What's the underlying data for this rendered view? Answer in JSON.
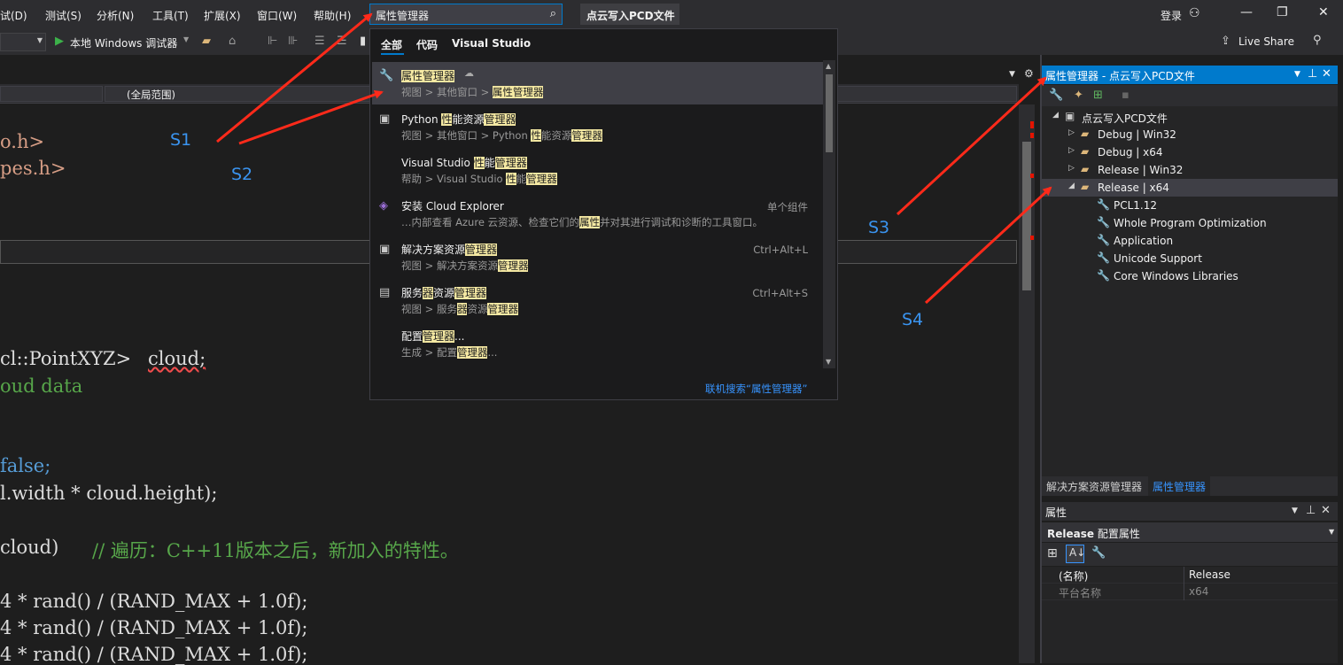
{
  "menu": [
    "试(D)",
    "测试(S)",
    "分析(N)",
    "工具(T)",
    "扩展(X)",
    "窗口(W)",
    "帮助(H)"
  ],
  "search": {
    "query": "属性管理器"
  },
  "solution_title": "点云写入PCD文件",
  "account": {
    "login": "登录"
  },
  "toolbar": {
    "debugger": "本地 Windows 调试器",
    "live_share": "Live Share"
  },
  "scope": {
    "global": "(全局范围)"
  },
  "code_lines": [
    {
      "id": "l1",
      "text": "o.h>"
    },
    {
      "id": "l2",
      "text": "pes.h>"
    },
    {
      "id": "l3",
      "text": "cl::PointXYZ> "
    },
    {
      "id": "l3b",
      "text": "cloud;"
    },
    {
      "id": "l4",
      "text": "oud data"
    },
    {
      "id": "l5",
      "text": "false;"
    },
    {
      "id": "l6",
      "text": "l.width * cloud.height);"
    },
    {
      "id": "l7a",
      "text": "cloud)   "
    },
    {
      "id": "l7b",
      "text": "// 遍历：C++11版本之后，新加入的特性。"
    },
    {
      "id": "l8",
      "text": "4 * rand() / (RAND_MAX + 1.0f);"
    },
    {
      "id": "l9",
      "text": "4 * rand() / (RAND_MAX + 1.0f);"
    },
    {
      "id": "l10",
      "text": "4 * rand() / (RAND_MAX + 1.0f);"
    }
  ],
  "popup": {
    "tabs": [
      "全部",
      "代码",
      "Visual Studio"
    ],
    "results": [
      {
        "title": [
          "",
          "属性管理器",
          ""
        ],
        "sub": [
          "视图 > 其他窗口 > ",
          "属性管理器",
          ""
        ],
        "right": "",
        "icon": "🔧"
      },
      {
        "title": [
          "Python ",
          "性",
          "能资源",
          "管理器"
        ],
        "sub": [
          "视图 > 其他窗口 > Python ",
          "性",
          "能资源",
          "管理器"
        ],
        "right": "",
        "icon": "▣"
      },
      {
        "title": [
          "Visual Studio ",
          "性",
          "能",
          "管理器"
        ],
        "sub": [
          "帮助 > Visual Studio ",
          "性",
          "能",
          "管理器"
        ],
        "right": "",
        "icon": ""
      },
      {
        "title": [
          "安装 Cloud Explorer"
        ],
        "sub": [
          "…内部查看 Azure 云资源、检查它们的",
          "属性",
          "并对其进行调试和诊断的工具窗口。"
        ],
        "right": "单个组件",
        "icon": "◈"
      },
      {
        "title": [
          "解决方案资源",
          "管理器"
        ],
        "sub": [
          "视图 > 解决方案资源",
          "管理器"
        ],
        "right": "Ctrl+Alt+L",
        "icon": "▣"
      },
      {
        "title": [
          "服务",
          "器",
          "资源",
          "管理器"
        ],
        "sub": [
          "视图 > 服务",
          "器",
          "资源",
          "管理器"
        ],
        "right": "Ctrl+Alt+S",
        "icon": "▤"
      },
      {
        "title": [
          "配置",
          "管理器",
          "..."
        ],
        "sub": [
          "生成 > 配置",
          "管理器",
          "..."
        ],
        "right": "",
        "icon": ""
      }
    ],
    "online": "联机搜索“属性管理器”"
  },
  "pm": {
    "header": "属性管理器 - 点云写入PCD文件",
    "tree": [
      {
        "label": "点云写入PCD文件",
        "level": 0,
        "arrow": "◢",
        "icon": "proj"
      },
      {
        "label": "Debug | Win32",
        "level": 1,
        "arrow": "▷",
        "icon": "folder"
      },
      {
        "label": "Debug | x64",
        "level": 1,
        "arrow": "▷",
        "icon": "folder"
      },
      {
        "label": "Release | Win32",
        "level": 1,
        "arrow": "▷",
        "icon": "folder"
      },
      {
        "label": "Release | x64",
        "level": 1,
        "arrow": "◢",
        "icon": "folder-open"
      },
      {
        "label": "PCL1.12",
        "level": 2,
        "arrow": "",
        "icon": "wrench"
      },
      {
        "label": "Whole Program Optimization",
        "level": 2,
        "arrow": "",
        "icon": "wrench"
      },
      {
        "label": "Application",
        "level": 2,
        "arrow": "",
        "icon": "wrench"
      },
      {
        "label": "Unicode Support",
        "level": 2,
        "arrow": "",
        "icon": "wrench"
      },
      {
        "label": "Core Windows Libraries",
        "level": 2,
        "arrow": "",
        "icon": "wrench"
      }
    ],
    "tabs": [
      "解决方案资源管理器",
      "属性管理器"
    ]
  },
  "props": {
    "title": "属性",
    "object_name": "Release",
    "object_type": "配置属性",
    "rows": [
      {
        "key": "(名称)",
        "value": "Release"
      },
      {
        "key": "平台名称",
        "value": "x64"
      }
    ]
  },
  "annotations": [
    "S1",
    "S2",
    "S3",
    "S4"
  ],
  "colors": {
    "accent": "#007acc",
    "highlight": "#f5e9a3",
    "arrow": "#ff2a1a",
    "annotation": "#3a94f0"
  }
}
